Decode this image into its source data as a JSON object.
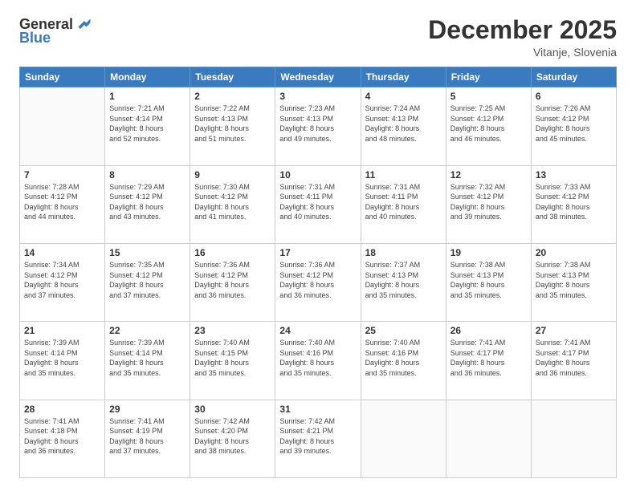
{
  "logo": {
    "general": "General",
    "blue": "Blue"
  },
  "header": {
    "month": "December 2025",
    "location": "Vitanje, Slovenia"
  },
  "weekdays": [
    "Sunday",
    "Monday",
    "Tuesday",
    "Wednesday",
    "Thursday",
    "Friday",
    "Saturday"
  ],
  "weeks": [
    [
      {
        "day": "",
        "info": ""
      },
      {
        "day": "1",
        "info": "Sunrise: 7:21 AM\nSunset: 4:14 PM\nDaylight: 8 hours\nand 52 minutes."
      },
      {
        "day": "2",
        "info": "Sunrise: 7:22 AM\nSunset: 4:13 PM\nDaylight: 8 hours\nand 51 minutes."
      },
      {
        "day": "3",
        "info": "Sunrise: 7:23 AM\nSunset: 4:13 PM\nDaylight: 8 hours\nand 49 minutes."
      },
      {
        "day": "4",
        "info": "Sunrise: 7:24 AM\nSunset: 4:13 PM\nDaylight: 8 hours\nand 48 minutes."
      },
      {
        "day": "5",
        "info": "Sunrise: 7:25 AM\nSunset: 4:12 PM\nDaylight: 8 hours\nand 46 minutes."
      },
      {
        "day": "6",
        "info": "Sunrise: 7:26 AM\nSunset: 4:12 PM\nDaylight: 8 hours\nand 45 minutes."
      }
    ],
    [
      {
        "day": "7",
        "info": "Sunrise: 7:28 AM\nSunset: 4:12 PM\nDaylight: 8 hours\nand 44 minutes."
      },
      {
        "day": "8",
        "info": "Sunrise: 7:29 AM\nSunset: 4:12 PM\nDaylight: 8 hours\nand 43 minutes."
      },
      {
        "day": "9",
        "info": "Sunrise: 7:30 AM\nSunset: 4:12 PM\nDaylight: 8 hours\nand 41 minutes."
      },
      {
        "day": "10",
        "info": "Sunrise: 7:31 AM\nSunset: 4:11 PM\nDaylight: 8 hours\nand 40 minutes."
      },
      {
        "day": "11",
        "info": "Sunrise: 7:31 AM\nSunset: 4:11 PM\nDaylight: 8 hours\nand 40 minutes."
      },
      {
        "day": "12",
        "info": "Sunrise: 7:32 AM\nSunset: 4:12 PM\nDaylight: 8 hours\nand 39 minutes."
      },
      {
        "day": "13",
        "info": "Sunrise: 7:33 AM\nSunset: 4:12 PM\nDaylight: 8 hours\nand 38 minutes."
      }
    ],
    [
      {
        "day": "14",
        "info": "Sunrise: 7:34 AM\nSunset: 4:12 PM\nDaylight: 8 hours\nand 37 minutes."
      },
      {
        "day": "15",
        "info": "Sunrise: 7:35 AM\nSunset: 4:12 PM\nDaylight: 8 hours\nand 37 minutes."
      },
      {
        "day": "16",
        "info": "Sunrise: 7:36 AM\nSunset: 4:12 PM\nDaylight: 8 hours\nand 36 minutes."
      },
      {
        "day": "17",
        "info": "Sunrise: 7:36 AM\nSunset: 4:12 PM\nDaylight: 8 hours\nand 36 minutes."
      },
      {
        "day": "18",
        "info": "Sunrise: 7:37 AM\nSunset: 4:13 PM\nDaylight: 8 hours\nand 35 minutes."
      },
      {
        "day": "19",
        "info": "Sunrise: 7:38 AM\nSunset: 4:13 PM\nDaylight: 8 hours\nand 35 minutes."
      },
      {
        "day": "20",
        "info": "Sunrise: 7:38 AM\nSunset: 4:13 PM\nDaylight: 8 hours\nand 35 minutes."
      }
    ],
    [
      {
        "day": "21",
        "info": "Sunrise: 7:39 AM\nSunset: 4:14 PM\nDaylight: 8 hours\nand 35 minutes."
      },
      {
        "day": "22",
        "info": "Sunrise: 7:39 AM\nSunset: 4:14 PM\nDaylight: 8 hours\nand 35 minutes."
      },
      {
        "day": "23",
        "info": "Sunrise: 7:40 AM\nSunset: 4:15 PM\nDaylight: 8 hours\nand 35 minutes."
      },
      {
        "day": "24",
        "info": "Sunrise: 7:40 AM\nSunset: 4:16 PM\nDaylight: 8 hours\nand 35 minutes."
      },
      {
        "day": "25",
        "info": "Sunrise: 7:40 AM\nSunset: 4:16 PM\nDaylight: 8 hours\nand 35 minutes."
      },
      {
        "day": "26",
        "info": "Sunrise: 7:41 AM\nSunset: 4:17 PM\nDaylight: 8 hours\nand 36 minutes."
      },
      {
        "day": "27",
        "info": "Sunrise: 7:41 AM\nSunset: 4:17 PM\nDaylight: 8 hours\nand 36 minutes."
      }
    ],
    [
      {
        "day": "28",
        "info": "Sunrise: 7:41 AM\nSunset: 4:18 PM\nDaylight: 8 hours\nand 36 minutes."
      },
      {
        "day": "29",
        "info": "Sunrise: 7:41 AM\nSunset: 4:19 PM\nDaylight: 8 hours\nand 37 minutes."
      },
      {
        "day": "30",
        "info": "Sunrise: 7:42 AM\nSunset: 4:20 PM\nDaylight: 8 hours\nand 38 minutes."
      },
      {
        "day": "31",
        "info": "Sunrise: 7:42 AM\nSunset: 4:21 PM\nDaylight: 8 hours\nand 39 minutes."
      },
      {
        "day": "",
        "info": ""
      },
      {
        "day": "",
        "info": ""
      },
      {
        "day": "",
        "info": ""
      }
    ]
  ]
}
